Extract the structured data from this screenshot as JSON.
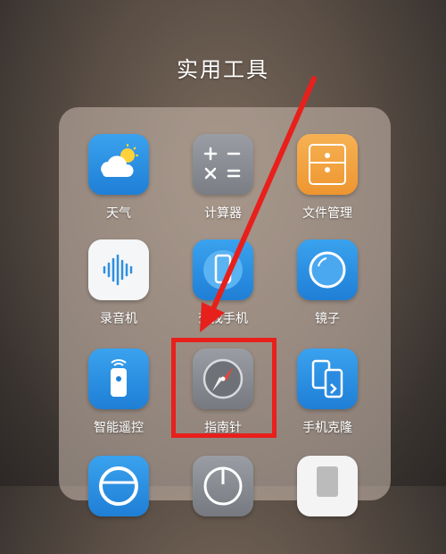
{
  "folder": {
    "title": "实用工具"
  },
  "apps": [
    {
      "id": "weather",
      "label": "天气",
      "icon": "weather-icon"
    },
    {
      "id": "calculator",
      "label": "计算器",
      "icon": "calculator-icon"
    },
    {
      "id": "file-manager",
      "label": "文件管理",
      "icon": "folder-icon"
    },
    {
      "id": "recorder",
      "label": "录音机",
      "icon": "soundwave-icon"
    },
    {
      "id": "phone-finder",
      "label": "查找手机",
      "icon": "phone-icon"
    },
    {
      "id": "mirror",
      "label": "镜子",
      "icon": "mirror-icon"
    },
    {
      "id": "remote",
      "label": "智能遥控",
      "icon": "remote-icon"
    },
    {
      "id": "compass",
      "label": "指南针",
      "icon": "compass-icon"
    },
    {
      "id": "phone-clone",
      "label": "手机克隆",
      "icon": "phone-clone-icon"
    }
  ],
  "colors": {
    "annotation": "#e8201c",
    "blue_icon": "#2f8fe0",
    "grey_icon": "#8a8e94",
    "orange_icon": "#f2a13e"
  }
}
